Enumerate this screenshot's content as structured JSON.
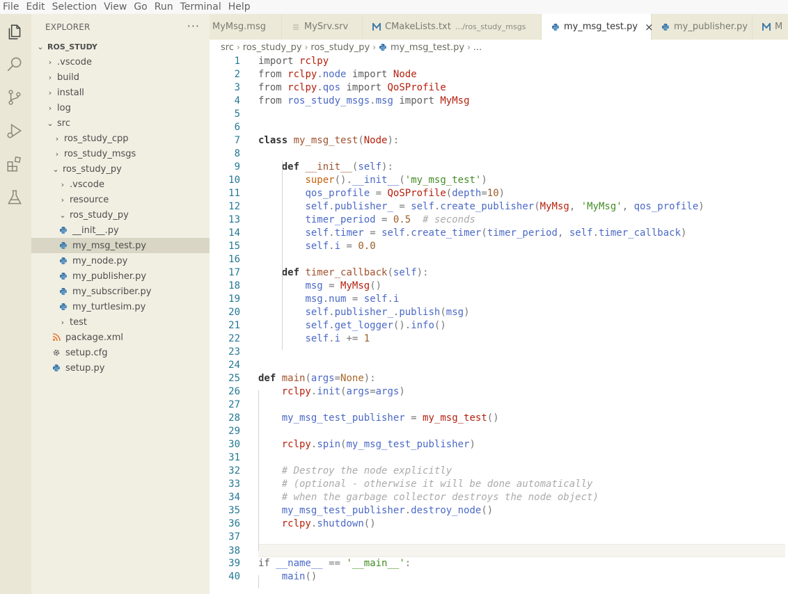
{
  "menu": [
    "File",
    "Edit",
    "Selection",
    "View",
    "Go",
    "Run",
    "Terminal",
    "Help"
  ],
  "activity_bar": [
    "explorer-icon",
    "search-icon",
    "source-control-icon",
    "run-debug-icon",
    "extensions-icon",
    "testing-icon"
  ],
  "sidebar": {
    "title": "EXPLORER",
    "more": "···",
    "root": "ROS_STUDY",
    "tree": [
      {
        "label": ".vscode",
        "chevron": "›",
        "icon": "folder"
      },
      {
        "label": "build",
        "chevron": "›",
        "icon": "folder"
      },
      {
        "label": "install",
        "chevron": "›",
        "icon": "folder"
      },
      {
        "label": "log",
        "chevron": "›",
        "icon": "folder"
      },
      {
        "label": "src",
        "chevron": "⌄",
        "icon": "folder"
      },
      {
        "label": "ros_study_cpp",
        "chevron": "›",
        "icon": "folder"
      },
      {
        "label": "ros_study_msgs",
        "chevron": "›",
        "icon": "folder"
      },
      {
        "label": "ros_study_py",
        "chevron": "⌄",
        "icon": "folder"
      },
      {
        "label": ".vscode",
        "chevron": "›",
        "icon": "folder"
      },
      {
        "label": "resource",
        "chevron": "›",
        "icon": "folder"
      },
      {
        "label": "ros_study_py",
        "chevron": "⌄",
        "icon": "folder"
      },
      {
        "label": "__init__.py",
        "chevron": "",
        "icon": "python"
      },
      {
        "label": "my_msg_test.py",
        "chevron": "",
        "icon": "python"
      },
      {
        "label": "my_node.py",
        "chevron": "",
        "icon": "python"
      },
      {
        "label": "my_publisher.py",
        "chevron": "",
        "icon": "python"
      },
      {
        "label": "my_subscriber.py",
        "chevron": "",
        "icon": "python"
      },
      {
        "label": "my_turtlesim.py",
        "chevron": "",
        "icon": "python"
      },
      {
        "label": "test",
        "chevron": "›",
        "icon": "folder"
      },
      {
        "label": "package.xml",
        "chevron": "",
        "icon": "rss"
      },
      {
        "label": "setup.cfg",
        "chevron": "",
        "icon": "gear"
      },
      {
        "label": "setup.py",
        "chevron": "",
        "icon": "python"
      }
    ]
  },
  "tabs": [
    {
      "label": "MyMsg.msg",
      "desc": "",
      "icon": "file"
    },
    {
      "label": "MySrv.srv",
      "desc": "",
      "icon": "file"
    },
    {
      "label": "CMakeLists.txt",
      "desc": ".../ros_study_msgs",
      "icon": "cmake"
    },
    {
      "label": "my_msg_test.py",
      "desc": "",
      "icon": "python",
      "close": "×"
    },
    {
      "label": "my_publisher.py",
      "desc": "",
      "icon": "python"
    },
    {
      "label": "M",
      "desc": "",
      "icon": "cmake"
    }
  ],
  "breadcrumb": [
    "src",
    "ros_study_py",
    "ros_study_py",
    "my_msg_test.py",
    "..."
  ],
  "colors": {
    "activity_bar": "#eae7d6",
    "sidebar": "#f1efe2",
    "selected": "#d9d6c5",
    "python": "#3572a5",
    "line_number": "#237893"
  },
  "code": [
    "import rclpy",
    "from rclpy.node import Node",
    "from rclpy.qos import QoSProfile",
    "from ros_study_msgs.msg import MyMsg",
    "",
    "",
    "class my_msg_test(Node):",
    "",
    "    def __init__(self):",
    "        super().__init__('my_msg_test')",
    "        qos_profile = QoSProfile(depth=10)",
    "        self.publisher_ = self.create_publisher(MyMsg, 'MyMsg', qos_profile)",
    "        timer_period = 0.5  # seconds",
    "        self.timer = self.create_timer(timer_period, self.timer_callback)",
    "        self.i = 0.0",
    "",
    "    def timer_callback(self):",
    "        msg = MyMsg()",
    "        msg.num = self.i",
    "        self.publisher_.publish(msg)",
    "        self.get_logger().info()",
    "        self.i += 1",
    "",
    "",
    "def main(args=None):",
    "    rclpy.init(args=args)",
    "",
    "    my_msg_test_publisher = my_msg_test()",
    "",
    "    rclpy.spin(my_msg_test_publisher)",
    "",
    "    # Destroy the node explicitly",
    "    # (optional - otherwise it will be done automatically",
    "    # when the garbage collector destroys the node object)",
    "    my_msg_test_publisher.destroy_node()",
    "    rclpy.shutdown()",
    "",
    "",
    "if __name__ == '__main__':",
    "    main()"
  ],
  "current_line": 38
}
